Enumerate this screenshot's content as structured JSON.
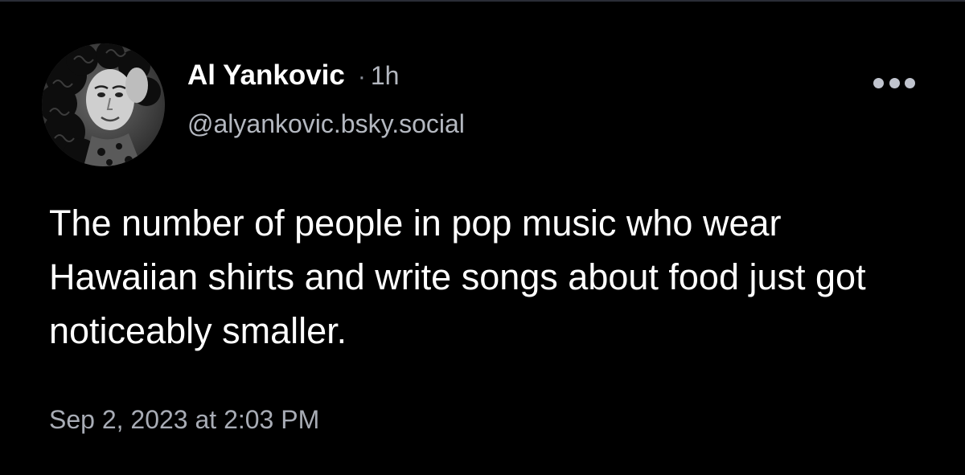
{
  "post": {
    "author": {
      "display_name": "Al Yankovic",
      "separator": "·",
      "relative_time": "1h",
      "handle": "@alyankovic.bsky.social",
      "avatar_icon": "avatar-photo"
    },
    "text": "The number of people in pop music who wear Hawaiian shirts and write songs about food just got noticeably smaller.",
    "timestamp": "Sep 2, 2023 at 2:03 PM",
    "more_icon": "ellipsis-icon"
  },
  "colors": {
    "background": "#000000",
    "primary_text": "#ffffff",
    "secondary_text": "#b4b8c0",
    "muted_text": "#a8acb5",
    "icon": "#c0c4ce"
  }
}
